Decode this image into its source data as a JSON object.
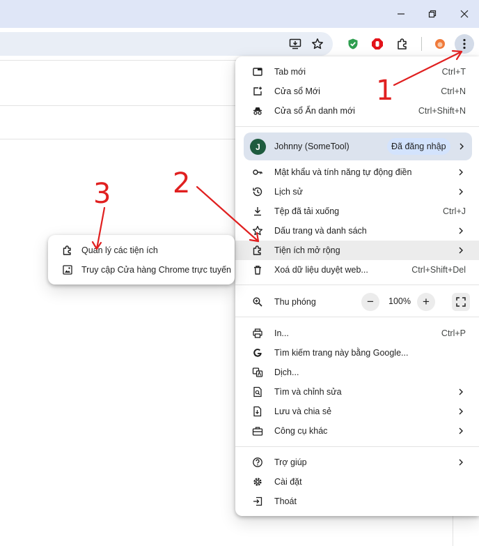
{
  "menu": {
    "items": [
      {
        "label": "Tab mới",
        "shortcut": "Ctrl+T",
        "icon": "new-tab-icon"
      },
      {
        "label": "Cửa sổ Mới",
        "shortcut": "Ctrl+N",
        "icon": "new-window-icon"
      },
      {
        "label": "Cửa sổ Ẩn danh mới",
        "shortcut": "Ctrl+Shift+N",
        "icon": "incognito-icon"
      },
      {
        "label": "Mật khẩu và tính năng tự động điền",
        "icon": "key-icon",
        "submenu": true
      },
      {
        "label": "Lịch sử",
        "icon": "history-icon",
        "submenu": true
      },
      {
        "label": "Tệp đã tải xuống",
        "shortcut": "Ctrl+J",
        "icon": "download-icon"
      },
      {
        "label": "Dấu trang và danh sách",
        "icon": "star-icon",
        "submenu": true
      },
      {
        "label": "Tiện ích mở rộng",
        "icon": "extension-icon",
        "submenu": true,
        "highlighted": true
      },
      {
        "label": "Xoá dữ liệu duyệt web...",
        "shortcut": "Ctrl+Shift+Del",
        "icon": "trash-icon"
      },
      {
        "label": "In...",
        "shortcut": "Ctrl+P",
        "icon": "print-icon"
      },
      {
        "label": "Tìm kiếm trang này bằng Google...",
        "icon": "google-icon"
      },
      {
        "label": "Dịch...",
        "icon": "translate-icon"
      },
      {
        "label": "Tìm và chỉnh sửa",
        "icon": "find-icon",
        "submenu": true
      },
      {
        "label": "Lưu và chia sẻ",
        "icon": "save-share-icon",
        "submenu": true
      },
      {
        "label": "Công cụ khác",
        "icon": "toolbox-icon",
        "submenu": true
      },
      {
        "label": "Trợ giúp",
        "icon": "help-icon",
        "submenu": true
      },
      {
        "label": "Cài đặt",
        "icon": "settings-gear-icon"
      },
      {
        "label": "Thoát",
        "icon": "exit-icon"
      }
    ],
    "profile": {
      "initial": "J",
      "name": "Johnny (SomeTool)",
      "status": "Đã đăng nhập"
    },
    "zoom": {
      "label": "Thu phóng",
      "minus": "−",
      "value": "100%",
      "plus": "+"
    }
  },
  "submenu": {
    "items": [
      {
        "label": "Quản lý các tiện ích",
        "icon": "extension-icon"
      },
      {
        "label": "Truy cập Cửa hàng Chrome trực tuyến",
        "icon": "web-store-icon"
      }
    ]
  },
  "annotations": {
    "step1": "1",
    "step2": "2",
    "step3": "3"
  },
  "colors": {
    "annotation": "#e02020",
    "titlebar": "#dfe6f7",
    "highlight": "#ececec",
    "avatar": "#1e5b3e",
    "badge": "#d3e3fd"
  }
}
